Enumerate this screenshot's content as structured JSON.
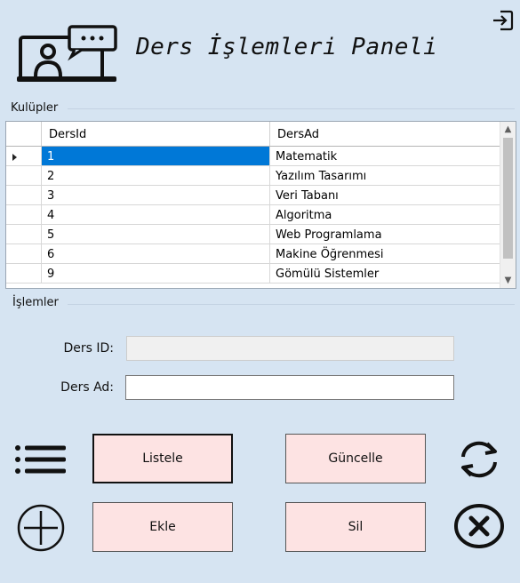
{
  "header": {
    "title": "Ders İşlemleri Paneli",
    "logo_icon": "online-class-icon",
    "exit_icon": "exit-icon"
  },
  "clubs_group": {
    "label": "Kulüpler"
  },
  "grid": {
    "columns": [
      "DersId",
      "DersAd"
    ],
    "selected_row": 0,
    "rows": [
      {
        "id": "1",
        "ad": "Matematik"
      },
      {
        "id": "2",
        "ad": "Yazılım Tasarımı"
      },
      {
        "id": "3",
        "ad": "Veri Tabanı"
      },
      {
        "id": "4",
        "ad": "Algoritma"
      },
      {
        "id": "5",
        "ad": "Web Programlama"
      },
      {
        "id": "6",
        "ad": "Makine Öğrenmesi"
      },
      {
        "id": "9",
        "ad": "Gömülü Sistemler"
      }
    ]
  },
  "ops_group": {
    "label": "İşlemler",
    "ders_id_label": "Ders ID:",
    "ders_id_value": "",
    "ders_ad_label": "Ders Ad:",
    "ders_ad_value": ""
  },
  "buttons": {
    "listele": "Listele",
    "guncelle": "Güncelle",
    "ekle": "Ekle",
    "sil": "Sil"
  },
  "icons": {
    "list": "list-icon",
    "refresh": "refresh-icon",
    "add": "add-circle-icon",
    "delete": "delete-circle-icon"
  }
}
